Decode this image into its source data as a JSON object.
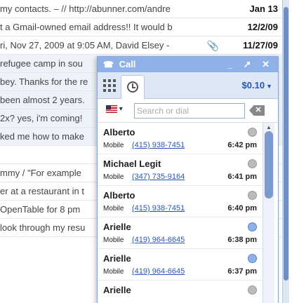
{
  "inbox": {
    "rows": [
      {
        "snippet": "my contacts. – // http://abunner.com/andre",
        "date": "Jan 13",
        "read": false
      },
      {
        "snippet": "t a Gmail-owned email address!! It would b",
        "date": "12/2/09",
        "read": false
      },
      {
        "snippet": "ri, Nov 27, 2009 at 9:05 AM, David Elsey -",
        "date": "11/27/09",
        "read": false,
        "attachment": true
      },
      {
        "snippet": "refugee camp in sou",
        "date": "",
        "read": true
      },
      {
        "snippet": "bey. Thanks for the re",
        "date": "",
        "read": true
      },
      {
        "snippet": "been almost 2 years.",
        "date": "",
        "read": true
      },
      {
        "snippet": "2x? yes, i'm coming!",
        "date": "",
        "read": true
      },
      {
        "snippet": "ked me how to make",
        "date": "",
        "read": true
      },
      {
        "snippet": "",
        "date": "",
        "read": false
      },
      {
        "snippet": "mmy / \"For example",
        "date": "",
        "read": false
      },
      {
        "snippet": "er at a restaurant in t",
        "date": "",
        "read": false
      },
      {
        "snippet": "OpenTable for 8 pm",
        "date": "",
        "read": false
      },
      {
        "snippet": "look through my resu",
        "date": "",
        "read": false
      }
    ]
  },
  "call_window": {
    "title": "Call",
    "controls": "_ ↗ ✕",
    "credit": "$0.10",
    "search_placeholder": "Search or dial",
    "entries": [
      {
        "name": "Alberto",
        "type": "Mobile",
        "number": "(415) 938-7451",
        "time": "6:42 pm",
        "status": "normal"
      },
      {
        "name": "Michael Legit",
        "type": "Mobile",
        "number": "(347) 735-9164",
        "time": "6:41 pm",
        "status": "normal"
      },
      {
        "name": "Alberto",
        "type": "Mobile",
        "number": "(415) 938-7451",
        "time": "6:40 pm",
        "status": "normal"
      },
      {
        "name": "Arielle",
        "type": "Mobile",
        "number": "(419) 964-6645",
        "time": "6:38 pm",
        "status": "missed"
      },
      {
        "name": "Arielle",
        "type": "Mobile",
        "number": "(419) 964-6645",
        "time": "6:37 pm",
        "status": "missed"
      },
      {
        "name": "Arielle",
        "type": "",
        "number": "",
        "time": "",
        "status": "normal"
      }
    ]
  },
  "colors": {
    "titlebar": "#8fb1e8",
    "link": "#2a55b5",
    "tabbar": "#dde7f5"
  },
  "icons": {
    "titlebar": "phone-icon",
    "keypad_tab": "keypad-icon",
    "history_tab": "clock-icon",
    "clear": "backspace-icon",
    "country": "us-flag-icon"
  }
}
